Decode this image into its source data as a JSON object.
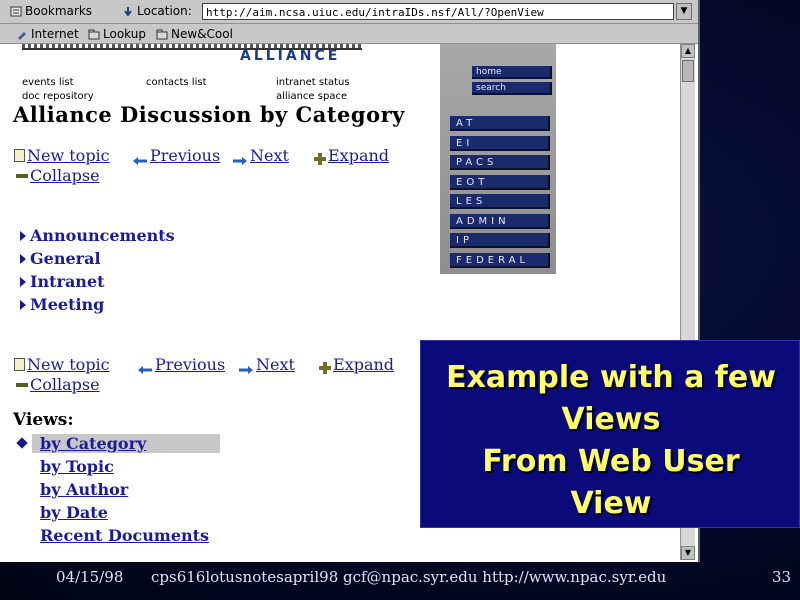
{
  "browser": {
    "toolbar": {
      "bookmarks_label": "Bookmarks",
      "location_label": "Location:",
      "url": "http://aim.ncsa.uiuc.edu/intraIDs.nsf/All/?OpenView"
    },
    "personal_toolbar": {
      "items": [
        "Internet",
        "Lookup",
        "New&Cool"
      ]
    },
    "page": {
      "logo_text": "ALLIANCE",
      "nav_links": [
        "events list",
        "contacts list",
        "intranet status",
        "doc repository",
        "alliance space"
      ],
      "side_nav": [
        "home",
        "search"
      ],
      "category_buttons": [
        "AT",
        "EI",
        "PACS",
        "EOT",
        "LES",
        "ADMIN",
        "IP",
        "FEDERAL"
      ],
      "title": "Alliance Discussion by Category",
      "actions": {
        "new_topic": "New topic",
        "previous": "Previous",
        "next": "Next",
        "expand": "Expand",
        "collapse": "Collapse"
      },
      "categories": [
        "Announcements",
        "General",
        "Intranet",
        "Meeting"
      ],
      "views_label": "Views:",
      "views": [
        "by Category",
        "by Topic",
        "by Author",
        "by Date",
        "Recent Documents"
      ]
    }
  },
  "callout": {
    "text": "Example with a few\nViews\nFrom Web User\nView"
  },
  "footer": {
    "date": "04/15/98",
    "source": "cps616lotusnotesapril98  gcf@npac.syr.edu http://www.npac.syr.edu",
    "page_number": "33"
  },
  "colors": {
    "link": "#1a1aa0",
    "callout_bg": "#0a0a7a",
    "callout_text": "#ffff66",
    "slide_bg": "#030828"
  }
}
